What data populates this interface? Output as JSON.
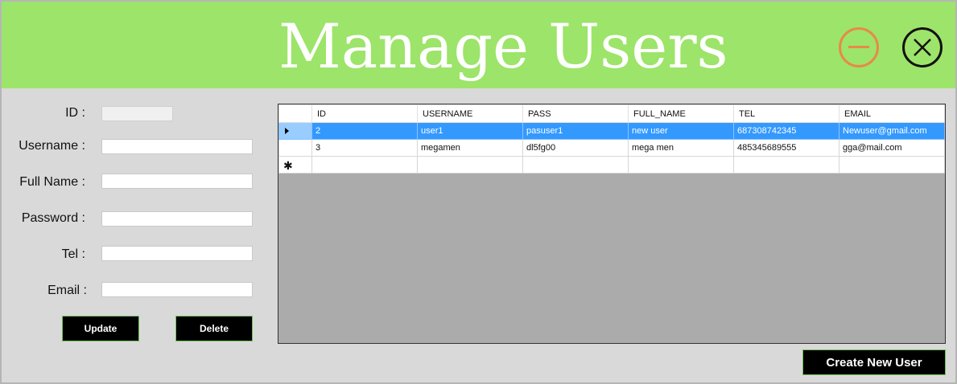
{
  "window": {
    "title": "Manage Users"
  },
  "form": {
    "id_label": "ID :",
    "username_label": "Username :",
    "fullname_label": "Full Name :",
    "password_label": "Password :",
    "tel_label": "Tel :",
    "email_label": "Email :",
    "id_value": "",
    "username_value": "",
    "fullname_value": "",
    "password_value": "",
    "tel_value": "",
    "email_value": ""
  },
  "buttons": {
    "update": "Update",
    "delete": "Delete",
    "create": "Create New User"
  },
  "grid": {
    "columns": [
      "ID",
      "USERNAME",
      "PASS",
      "FULL_NAME",
      "TEL",
      "EMAIL"
    ],
    "rows": [
      {
        "selected": true,
        "cells": [
          "2",
          "user1",
          "pasuser1",
          "new user",
          "687308742345",
          "Newuser@gmail.com"
        ]
      },
      {
        "selected": false,
        "cells": [
          "3",
          "megamen",
          "dl5fg00",
          "mega men",
          "485345689555",
          "gga@mail.com"
        ]
      }
    ]
  },
  "colors": {
    "header_bg": "#9de46a",
    "minimize_icon": "#e68a4a",
    "close_icon": "#111111",
    "selection": "#3399ff",
    "grid_empty": "#ababab"
  },
  "icons": {
    "minimize": "minus-circle-icon",
    "close": "x-circle-icon",
    "current_row": "triangle-right-icon",
    "new_row": "asterisk-icon"
  }
}
